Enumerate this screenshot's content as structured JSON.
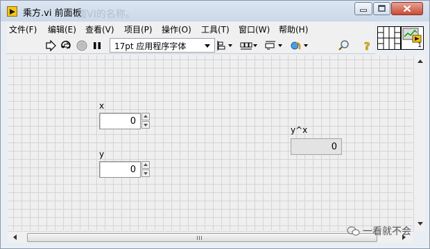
{
  "window": {
    "title": "乘方.vi 前面板",
    "ghost_title": "面VI的名称。"
  },
  "menu": [
    {
      "label": "文件(F)"
    },
    {
      "label": "编辑(E)"
    },
    {
      "label": "查看(V)"
    },
    {
      "label": "项目(P)"
    },
    {
      "label": "操作(O)"
    },
    {
      "label": "工具(T)"
    },
    {
      "label": "窗口(W)"
    },
    {
      "label": "帮助(H)"
    }
  ],
  "toolbar": {
    "font_select": "17pt 应用程序字体",
    "icons": [
      "run-arrow-icon",
      "run-continuously-icon",
      "abort-icon",
      "pause-icon",
      "align-objects-icon",
      "distribute-objects-icon",
      "resize-objects-icon",
      "reorder-icon",
      "search-icon",
      "context-help-icon"
    ]
  },
  "vi_icon": {
    "connector_number": "1"
  },
  "controls": {
    "x": {
      "label": "x",
      "value": "0"
    },
    "y": {
      "label": "y",
      "value": "0"
    }
  },
  "indicators": {
    "result": {
      "label": "y^x",
      "value": "0"
    }
  },
  "watermark": "一看就不会",
  "colors": {
    "canvas": "#efefef",
    "grid": "#d4d4d4",
    "indicator_bg": "#e3e3e3"
  }
}
